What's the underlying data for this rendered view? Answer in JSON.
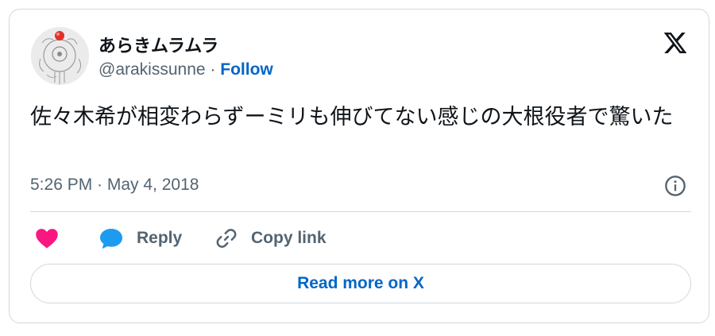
{
  "author": {
    "display_name": "あらきムラムラ",
    "handle": "@arakissunne",
    "separator": "·",
    "follow_label": "Follow"
  },
  "tweet": {
    "text": "佐々木希が相変わらずーミリも伸びてない感じの大根役者で驚いた",
    "timestamp": "5:26 PM · May 4, 2018"
  },
  "actions": {
    "like_icon": "heart-icon",
    "reply_label": "Reply",
    "reply_icon": "speech-bubble-icon",
    "copy_label": "Copy link",
    "copy_icon": "link-icon"
  },
  "footer": {
    "read_more_label": "Read more on X"
  },
  "colors": {
    "text": "#0f1419",
    "secondary": "#536471",
    "link": "#0066c8",
    "heart": "#f91880",
    "reply": "#1d9bf0",
    "border": "#cfd9de"
  }
}
